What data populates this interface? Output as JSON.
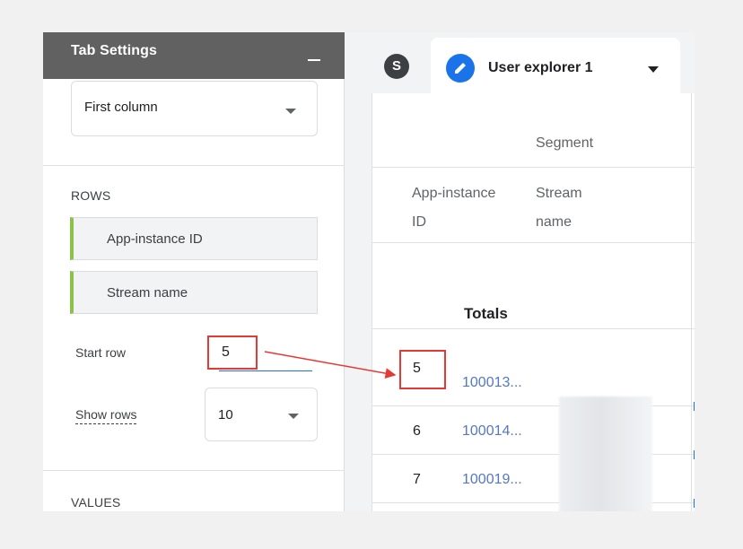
{
  "left_panel": {
    "title": "Tab Settings",
    "first_column_select": {
      "value": "First column"
    },
    "rows_section": {
      "label": "ROWS",
      "items": [
        {
          "label": "App-instance ID"
        },
        {
          "label": "Stream name"
        }
      ]
    },
    "start_row": {
      "label": "Start row",
      "value": "5"
    },
    "show_rows": {
      "label": "Show rows",
      "value": "10"
    },
    "values_section": {
      "label": "VALUES"
    }
  },
  "tabs": {
    "s_tab": {
      "label": "S"
    },
    "active": {
      "label": "User explorer 1"
    }
  },
  "table": {
    "segment_header": "Segment",
    "col_app_instance": {
      "line1": "App-instance",
      "line2": "ID"
    },
    "col_stream": {
      "line1": "Stream",
      "line2": "name"
    },
    "totals_label": "Totals",
    "rows": [
      {
        "num": "5",
        "id": "100013..."
      },
      {
        "num": "6",
        "id": "100014..."
      },
      {
        "num": "7",
        "id": "100019..."
      }
    ]
  },
  "colors": {
    "header_bg": "#616161",
    "accent_blue": "#1a73e8",
    "chip_green": "#8bc34a",
    "link_blue": "#5478c4",
    "annotation_red": "#e53935"
  },
  "icons": {
    "collapse": "minus-icon",
    "edit": "pencil-icon",
    "dropdown": "chevron-down-icon"
  }
}
